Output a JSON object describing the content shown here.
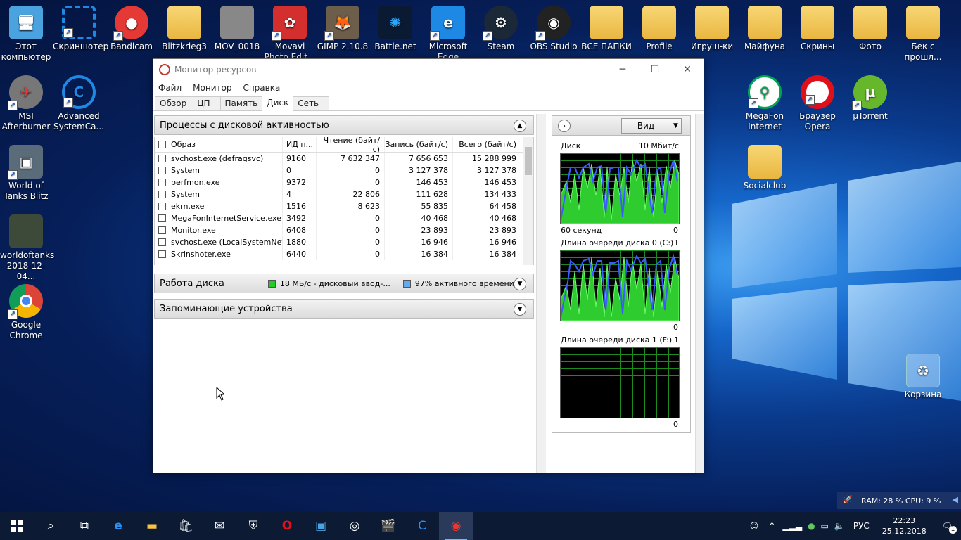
{
  "desktop": {
    "icons_top": [
      {
        "label": "Этот компьютер"
      },
      {
        "label": "Скриншотер"
      },
      {
        "label": "Bandicam"
      },
      {
        "label": "Blitzkrieg3"
      },
      {
        "label": "MOV_0018"
      },
      {
        "label": "Movavi Photo Edit..."
      },
      {
        "label": "GIMP 2.10.8"
      },
      {
        "label": "Battle.net"
      },
      {
        "label": "Microsoft Edge"
      },
      {
        "label": "Steam"
      },
      {
        "label": "OBS Studio"
      },
      {
        "label": "ВСЕ ПАПКИ"
      },
      {
        "label": "Profile"
      },
      {
        "label": "Игруш-ки"
      },
      {
        "label": "Майфуна"
      },
      {
        "label": "Скрины"
      },
      {
        "label": "Фото"
      },
      {
        "label": "Бек с прошл..."
      }
    ],
    "icons_left": [
      {
        "label": "MSI Afterburner"
      },
      {
        "label": "Advanced SystemCa..."
      },
      {
        "label": "World of Tanks Blitz"
      },
      {
        "label": "worldoftanks 2018-12-04..."
      },
      {
        "label": "Google Chrome"
      }
    ],
    "icons_right": [
      {
        "label": "MegaFon Internet"
      },
      {
        "label": "Браузер Opera"
      },
      {
        "label": "µTorrent"
      },
      {
        "label": "Socialclub"
      },
      {
        "label": "Корзина"
      }
    ]
  },
  "window": {
    "title": "Монитор ресурсов",
    "menu": [
      "Файл",
      "Монитор",
      "Справка"
    ],
    "tabs": [
      "Обзор",
      "ЦП",
      "Память",
      "Диск",
      "Сеть"
    ],
    "active_tab": "Диск",
    "section_processes": "Процессы с дисковой активностью",
    "columns": [
      "Образ",
      "ИД п...",
      "Чтение (байт/с)",
      "Запись (байт/с)",
      "Всего (байт/с)"
    ],
    "rows": [
      {
        "image": "svchost.exe (defragsvc)",
        "pid": "9160",
        "read": "7 632 347",
        "write": "7 656 653",
        "total": "15 288 999"
      },
      {
        "image": "System",
        "pid": "0",
        "read": "0",
        "write": "3 127 378",
        "total": "3 127 378"
      },
      {
        "image": "perfmon.exe",
        "pid": "9372",
        "read": "0",
        "write": "146 453",
        "total": "146 453"
      },
      {
        "image": "System",
        "pid": "4",
        "read": "22 806",
        "write": "111 628",
        "total": "134 433"
      },
      {
        "image": "ekrn.exe",
        "pid": "1516",
        "read": "8 623",
        "write": "55 835",
        "total": "64 458"
      },
      {
        "image": "MegaFonInternetService.exe",
        "pid": "3492",
        "read": "0",
        "write": "40 468",
        "total": "40 468"
      },
      {
        "image": "Monitor.exe",
        "pid": "6408",
        "read": "0",
        "write": "23 893",
        "total": "23 893"
      },
      {
        "image": "svchost.exe (LocalSystemNet...",
        "pid": "1880",
        "read": "0",
        "write": "16 946",
        "total": "16 946"
      },
      {
        "image": "Skrinshoter.exe",
        "pid": "6440",
        "read": "0",
        "write": "16 384",
        "total": "16 384"
      }
    ],
    "section_disk": "Работа диска",
    "disk_legend_io": "18 МБ/с - дисковый ввод-...",
    "disk_legend_active": "97% активного времени (...",
    "legend_colors": {
      "io": "#22cc22",
      "active": "#66aaee"
    },
    "section_storage": "Запоминающие устройства",
    "view_button": "Вид",
    "graphs": [
      {
        "title": "Диск",
        "top_value": "10 Мбит/с",
        "bottom_left": "60 секунд",
        "bottom_right": "0"
      },
      {
        "title": "Длина очереди диска 0 (C:)",
        "top_value": "1",
        "bottom_left": "",
        "bottom_right": "0"
      },
      {
        "title": "Длина очереди диска 1 (F:)",
        "top_value": "1",
        "bottom_left": "",
        "bottom_right": "0"
      }
    ]
  },
  "taskbar": {
    "lang": "РУС",
    "time": "22:23",
    "date": "25.12.2018",
    "notif_count": "1",
    "ram_cpu": "RAM: 28 %  CPU: 9 %"
  }
}
